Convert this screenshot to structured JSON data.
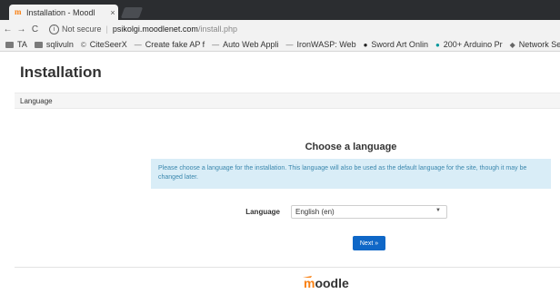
{
  "browser": {
    "tab_title": "Installation - Moodl",
    "tab_close": "×",
    "favicon": "m",
    "nav": {
      "back": "←",
      "forward": "→",
      "reload": "C"
    },
    "info_glyph": "i",
    "security_label": "Not secure",
    "url_separator": "|",
    "url_host": "psikolgi.moodlenet.com",
    "url_path": "/install.php",
    "bookmarks": [
      {
        "icon": "folder-icon",
        "label": "TA"
      },
      {
        "icon": "folder-icon",
        "label": "sqlivuln"
      },
      {
        "icon": "citeseer-icon",
        "glyph": "©",
        "label": "CiteSeerX"
      },
      {
        "icon": "dash-icon",
        "glyph": "—",
        "label": "Create fake AP f"
      },
      {
        "icon": "dash-icon",
        "glyph": "—",
        "label": "Auto Web Appli"
      },
      {
        "icon": "dash-icon",
        "glyph": "—",
        "label": "IronWASP: Web"
      },
      {
        "icon": "shield-icon",
        "glyph": "●",
        "label": "Sword Art Onlin"
      },
      {
        "icon": "arduino-icon",
        "glyph": "●",
        "label": "200+ Arduino Pr"
      },
      {
        "icon": "network-icon",
        "glyph": "◆",
        "label": "Network Se"
      }
    ]
  },
  "page": {
    "title": "Installation",
    "navbar_label": "Language",
    "section_heading": "Choose a language",
    "alert_text": "Please choose a language for the installation. This language will also be used as the default language for the site, though it may be changed later.",
    "form": {
      "label": "Language",
      "selected": "English (en)",
      "caret": "▼"
    },
    "next_button": "Next »",
    "logo_text": "moodle"
  },
  "colors": {
    "alert_bg": "#d9edf7",
    "alert_text": "#3a87ad",
    "button_bg": "#0f67c7",
    "logo_orange": "#f98012",
    "logo_gray": "#333333"
  }
}
